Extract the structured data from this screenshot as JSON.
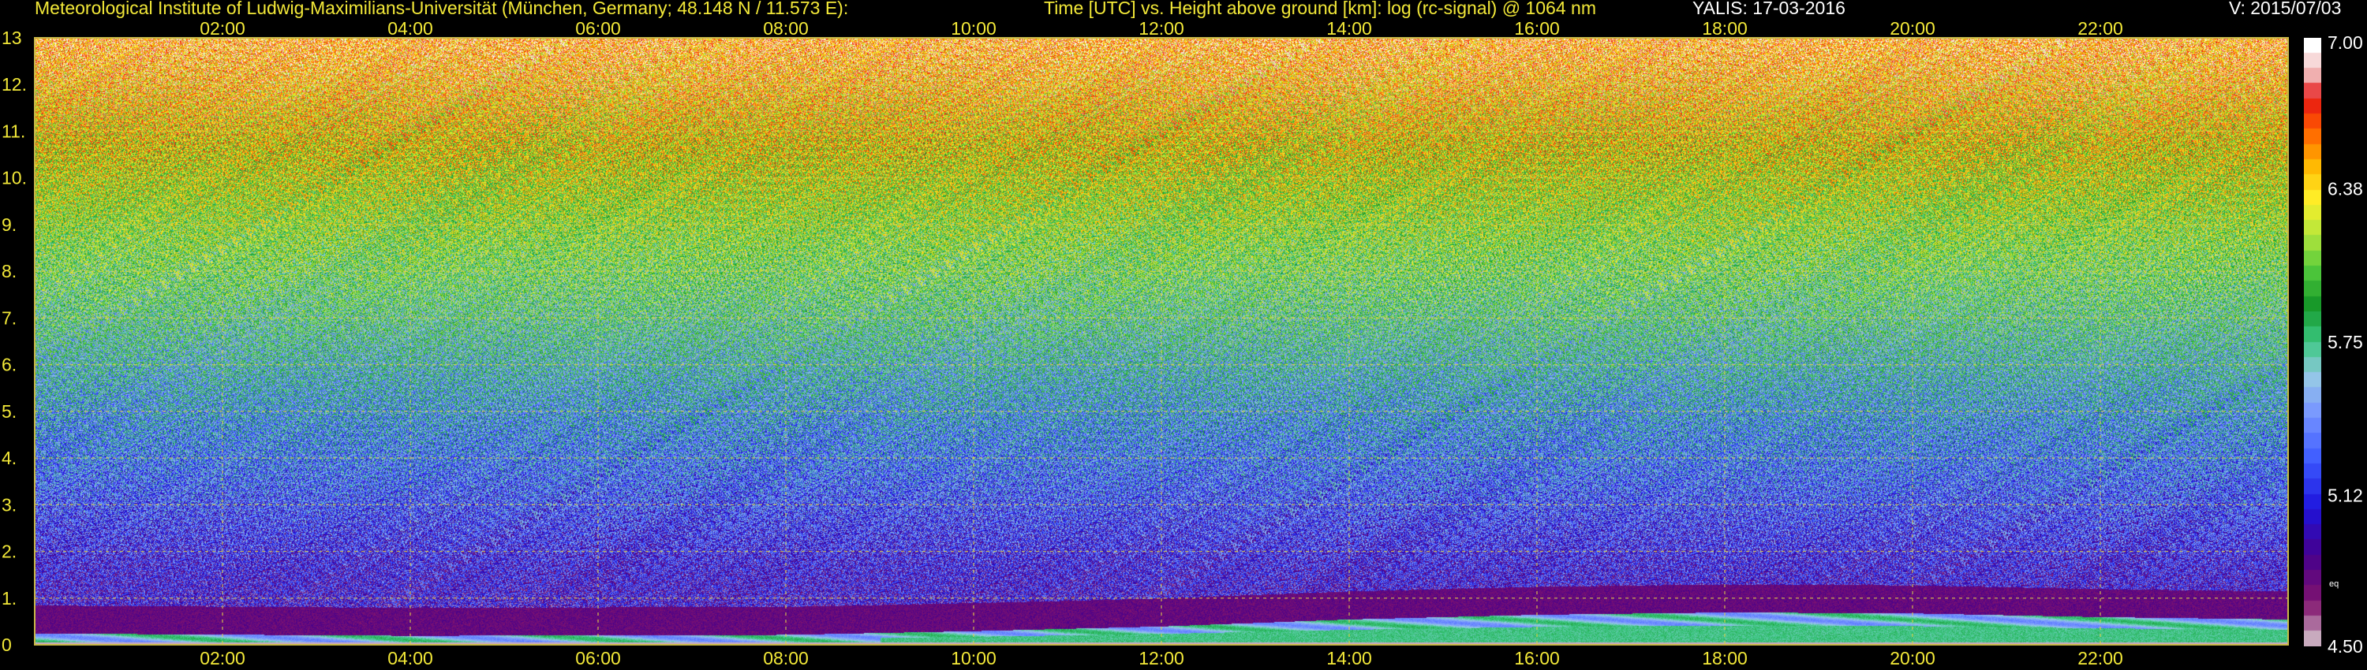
{
  "header": {
    "institute": "Meteorological Institute of Ludwig-Maximilians-Universität (München, Germany; 48.148 N / 11.573 E):",
    "plot_description": "Time [UTC] vs. Height above ground [km]: log (rc-signal) @ 1064 nm",
    "instrument_date": "YALIS: 17-03-2016",
    "version": "V: 2015/07/03"
  },
  "colorbar": {
    "tick_labels": [
      "7.00",
      "6.38",
      "5.75",
      "5.12",
      "4.50"
    ],
    "tick_values": [
      7.0,
      6.38,
      5.75,
      5.12,
      4.5
    ],
    "range": [
      4.5,
      7.0
    ],
    "small_label": "eq"
  },
  "colors": {
    "text_yellow": "#f2e838",
    "text_white": "#ffffff",
    "frame": "#c8b848",
    "grid": "#e0d24a",
    "background": "#000000"
  },
  "chart_data": {
    "type": "heatmap",
    "title": "Time [UTC] vs. Height above ground [km]: log (rc-signal) @ 1064 nm",
    "xlabel": "Time [UTC]",
    "ylabel": "Height above ground [km]",
    "x_range": [
      "00:00",
      "24:00"
    ],
    "x_tick_labels": [
      "02:00",
      "04:00",
      "06:00",
      "08:00",
      "10:00",
      "12:00",
      "14:00",
      "16:00",
      "18:00",
      "20:00",
      "22:00"
    ],
    "x_tick_hours": [
      2,
      4,
      6,
      8,
      10,
      12,
      14,
      16,
      18,
      20,
      22
    ],
    "ylim": [
      0,
      13
    ],
    "y_tick_labels": [
      "0",
      "1.",
      "2.",
      "3.",
      "4.",
      "5.",
      "6.",
      "7.",
      "8.",
      "9.",
      "10.",
      "11.",
      "12.",
      "13"
    ],
    "y_tick_values": [
      0,
      1,
      2,
      3,
      4,
      5,
      6,
      7,
      8,
      9,
      10,
      11,
      12,
      13
    ],
    "value_range": [
      4.5,
      7.0
    ],
    "grid": true,
    "legend_placement": "right colorbar",
    "boundary_layer_top_km": [
      {
        "hour": 0,
        "km": 0.25
      },
      {
        "hour": 4,
        "km": 0.2
      },
      {
        "hour": 8,
        "km": 0.22
      },
      {
        "hour": 10,
        "km": 0.3
      },
      {
        "hour": 12,
        "km": 0.4
      },
      {
        "hour": 14,
        "km": 0.55
      },
      {
        "hour": 16,
        "km": 0.65
      },
      {
        "hour": 18,
        "km": 0.7
      },
      {
        "hour": 20,
        "km": 0.68
      },
      {
        "hour": 22,
        "km": 0.6
      },
      {
        "hour": 24,
        "km": 0.55
      }
    ]
  }
}
